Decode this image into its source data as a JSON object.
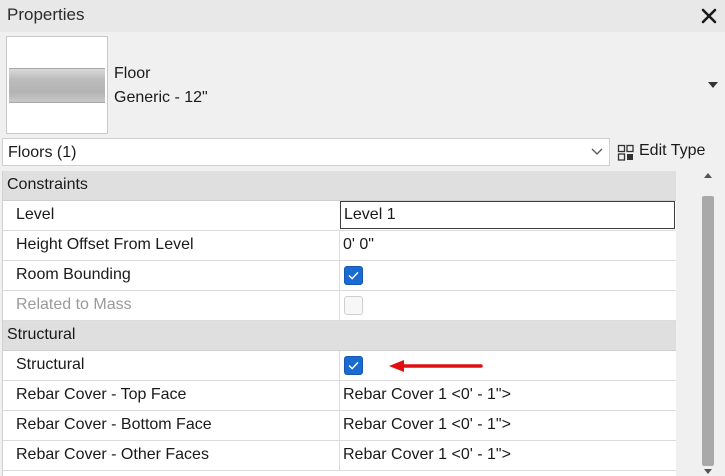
{
  "window": {
    "title": "Properties",
    "close_icon": "close-icon"
  },
  "type_selector": {
    "family": "Floor",
    "type": "Generic - 12\"",
    "dropdown_icon": "chevron-down-icon"
  },
  "instance_filter": {
    "selected": "Floors (1)",
    "edit_type_label": "Edit Type",
    "edit_type_icon": "edit-type-icon"
  },
  "groups": [
    {
      "name": "Constraints",
      "rows": [
        {
          "name": "Level",
          "value": "Level 1"
        },
        {
          "name": "Height Offset From Level",
          "value": "0'  0\""
        },
        {
          "name": "Room Bounding",
          "checked": true
        },
        {
          "name": "Related to Mass",
          "checked": false,
          "disabled": true
        }
      ]
    },
    {
      "name": "Structural",
      "rows": [
        {
          "name": "Structural",
          "checked": true
        },
        {
          "name": "Rebar Cover - Top Face",
          "value": "Rebar Cover 1 <0' - 1\">"
        },
        {
          "name": "Rebar Cover - Bottom Face",
          "value": "Rebar Cover 1 <0' - 1\">"
        },
        {
          "name": "Rebar Cover - Other Faces",
          "value": "Rebar Cover 1 <0' - 1\">"
        }
      ]
    }
  ],
  "colors": {
    "checkbox_on": "#1a6bd1",
    "annotation_arrow": "#e01010",
    "group_header": "#dfdfdf"
  }
}
